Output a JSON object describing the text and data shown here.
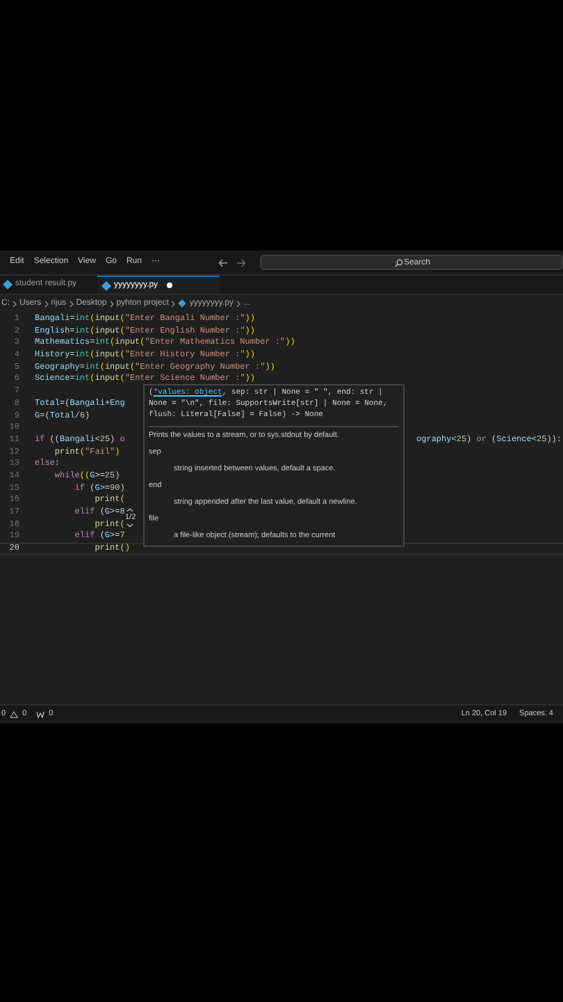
{
  "menu": [
    "Edit",
    "Selection",
    "View",
    "Go",
    "Run",
    "···"
  ],
  "search": {
    "placeholder": "Search"
  },
  "tabs": [
    {
      "label": "student result.py",
      "selected": false,
      "modified": false
    },
    {
      "label": "yyyyyyyy.py",
      "selected": true,
      "modified": true
    }
  ],
  "breadcrumb": [
    "C:",
    "Users",
    "rijus",
    "Desktop",
    "pyhton project",
    "yyyyyyyy.py",
    "..."
  ],
  "code_lines": [
    {
      "number": "1",
      "tokens": [
        {
          "kind": "var",
          "text": "Bangali"
        },
        {
          "kind": "plain",
          "text": "="
        },
        {
          "kind": "type",
          "text": "int"
        },
        {
          "kind": "paren",
          "text": "("
        },
        {
          "kind": "func",
          "text": "input"
        },
        {
          "kind": "paren",
          "text": "("
        },
        {
          "kind": "str",
          "text": "\"Enter Bangali Number :\""
        },
        {
          "kind": "paren",
          "text": "))"
        }
      ]
    },
    {
      "number": "2",
      "tokens": [
        {
          "kind": "var",
          "text": "English"
        },
        {
          "kind": "plain",
          "text": "="
        },
        {
          "kind": "type",
          "text": "int"
        },
        {
          "kind": "paren",
          "text": "("
        },
        {
          "kind": "func",
          "text": "input"
        },
        {
          "kind": "paren",
          "text": "("
        },
        {
          "kind": "str",
          "text": "\"Enter English Number :\""
        },
        {
          "kind": "paren",
          "text": "))"
        }
      ]
    },
    {
      "number": "3",
      "tokens": [
        {
          "kind": "var",
          "text": "Mathematics"
        },
        {
          "kind": "plain",
          "text": "="
        },
        {
          "kind": "type",
          "text": "int"
        },
        {
          "kind": "paren",
          "text": "("
        },
        {
          "kind": "func",
          "text": "input"
        },
        {
          "kind": "paren",
          "text": "("
        },
        {
          "kind": "str",
          "text": "\"Enter Mathematics Number :\""
        },
        {
          "kind": "paren",
          "text": "))"
        }
      ]
    },
    {
      "number": "4",
      "tokens": [
        {
          "kind": "var",
          "text": "History"
        },
        {
          "kind": "plain",
          "text": "="
        },
        {
          "kind": "type",
          "text": "int"
        },
        {
          "kind": "paren",
          "text": "("
        },
        {
          "kind": "func",
          "text": "input"
        },
        {
          "kind": "paren",
          "text": "("
        },
        {
          "kind": "str",
          "text": "\"Enter History Number :\""
        },
        {
          "kind": "paren",
          "text": "))"
        }
      ]
    },
    {
      "number": "5",
      "tokens": [
        {
          "kind": "var",
          "text": "Geography"
        },
        {
          "kind": "plain",
          "text": "="
        },
        {
          "kind": "type",
          "text": "int"
        },
        {
          "kind": "paren",
          "text": "("
        },
        {
          "kind": "func",
          "text": "input"
        },
        {
          "kind": "paren",
          "text": "("
        },
        {
          "kind": "str",
          "text": "\"Enter Geography Number :\""
        },
        {
          "kind": "paren",
          "text": "))"
        }
      ]
    },
    {
      "number": "6",
      "tokens": [
        {
          "kind": "var",
          "text": "Science"
        },
        {
          "kind": "plain",
          "text": "="
        },
        {
          "kind": "type",
          "text": "int"
        },
        {
          "kind": "paren",
          "text": "("
        },
        {
          "kind": "func",
          "text": "input"
        },
        {
          "kind": "paren",
          "text": "("
        },
        {
          "kind": "str",
          "text": "\"Enter Science Number :\""
        },
        {
          "kind": "paren",
          "text": "))"
        }
      ]
    },
    {
      "number": "7"
    },
    {
      "number": "8",
      "tokens": [
        {
          "kind": "var",
          "text": "Total"
        },
        {
          "kind": "plain",
          "text": "=("
        },
        {
          "kind": "var",
          "text": "Bangali"
        },
        {
          "kind": "plain",
          "text": "+"
        },
        {
          "kind": "var",
          "text": "Eng"
        }
      ]
    },
    {
      "number": "9",
      "tokens": [
        {
          "kind": "var",
          "text": "G"
        },
        {
          "kind": "plain",
          "text": "=("
        },
        {
          "kind": "var",
          "text": "Total"
        },
        {
          "kind": "plain",
          "text": "/"
        },
        {
          "kind": "num",
          "text": "6"
        },
        {
          "kind": "plain",
          "text": ")"
        }
      ]
    },
    {
      "number": "10"
    },
    {
      "number": "11",
      "tokens": [
        {
          "kind": "kw",
          "text": "if"
        },
        {
          "kind": "plain",
          "text": " (("
        },
        {
          "kind": "var",
          "text": "Bangali"
        },
        {
          "kind": "plain",
          "text": "<"
        },
        {
          "kind": "num",
          "text": "25"
        },
        {
          "kind": "plain",
          "text": ") "
        },
        {
          "kind": "kw",
          "text": "o"
        }
      ],
      "tail": [
        {
          "kind": "var",
          "text": "ography"
        },
        {
          "kind": "plain",
          "text": "<"
        },
        {
          "kind": "num",
          "text": "25"
        },
        {
          "kind": "plain",
          "text": ") "
        },
        {
          "kind": "kw",
          "text": "or"
        },
        {
          "kind": "plain",
          "text": " ("
        },
        {
          "kind": "var",
          "text": "Science"
        },
        {
          "kind": "plain",
          "text": "<"
        },
        {
          "kind": "num",
          "text": "25"
        },
        {
          "kind": "plain",
          "text": ")):"
        }
      ]
    },
    {
      "number": "12",
      "tokens": [
        {
          "kind": "func",
          "text": "    print"
        },
        {
          "kind": "paren",
          "text": "("
        },
        {
          "kind": "str",
          "text": "\"Fail\""
        },
        {
          "kind": "paren",
          "text": ")"
        }
      ]
    },
    {
      "number": "13",
      "tokens": [
        {
          "kind": "kw",
          "text": "else"
        },
        {
          "kind": "plain",
          "text": ":"
        }
      ]
    },
    {
      "number": "14",
      "tokens": [
        {
          "kind": "kw",
          "text": "    while"
        },
        {
          "kind": "paren",
          "text": "(("
        },
        {
          "kind": "var",
          "text": "G"
        },
        {
          "kind": "plain",
          "text": ">="
        },
        {
          "kind": "num",
          "text": "25"
        },
        {
          "kind": "plain",
          "text": ")"
        }
      ]
    },
    {
      "number": "15",
      "tokens": [
        {
          "kind": "kw",
          "text": "        if"
        },
        {
          "kind": "plain",
          "text": " ("
        },
        {
          "kind": "var",
          "text": "G"
        },
        {
          "kind": "plain",
          "text": ">="
        },
        {
          "kind": "num",
          "text": "90"
        },
        {
          "kind": "plain",
          "text": ")"
        }
      ]
    },
    {
      "number": "16",
      "tokens": [
        {
          "kind": "func",
          "text": "            print"
        },
        {
          "kind": "paren",
          "text": "("
        }
      ]
    },
    {
      "number": "17",
      "tokens": [
        {
          "kind": "kw",
          "text": "        elif"
        },
        {
          "kind": "plain",
          "text": " ("
        },
        {
          "kind": "var",
          "text": "G"
        },
        {
          "kind": "plain",
          "text": ">="
        },
        {
          "kind": "num",
          "text": "8"
        }
      ]
    },
    {
      "number": "18",
      "tokens": [
        {
          "kind": "func",
          "text": "            print"
        },
        {
          "kind": "paren",
          "text": "("
        }
      ]
    },
    {
      "number": "19",
      "tokens": [
        {
          "kind": "kw",
          "text": "        elif"
        },
        {
          "kind": "plain",
          "text": " ("
        },
        {
          "kind": "var",
          "text": "G"
        },
        {
          "kind": "plain",
          "text": ">="
        },
        {
          "kind": "num",
          "text": "7"
        }
      ]
    },
    {
      "number": "20",
      "current": true,
      "tokens": [
        {
          "kind": "func",
          "text": "            print"
        },
        {
          "kind": "paren",
          "text": "()"
        }
      ]
    }
  ],
  "overload": {
    "counter": "1/2"
  },
  "hover": {
    "signature": [
      [
        {
          "text": "(",
          "active": false
        },
        {
          "text": "*values: object",
          "active": true
        },
        {
          "text": ", sep: str | None = \" \", end: str |",
          "active": false
        }
      ],
      [
        {
          "text": "None = \"\\n\", file: SupportsWrite[str] | None = None,",
          "active": false
        }
      ],
      [
        {
          "text": "flush: Literal[False] = False) -> None",
          "active": false
        }
      ]
    ],
    "description": "Prints the values to a stream, or to sys.stdout by default.",
    "params": [
      {
        "name": "sep",
        "doc": "string inserted between values, default a space."
      },
      {
        "name": "end",
        "doc": "string appended after the last value, default a newline."
      },
      {
        "name": "file",
        "doc": "a file-like object (stream); defaults to the current"
      }
    ]
  },
  "status_bar": {
    "errors": "0",
    "warnings": "0",
    "ports": "0",
    "position": "Ln 20, Col 19",
    "indent": "Spaces: 4"
  }
}
